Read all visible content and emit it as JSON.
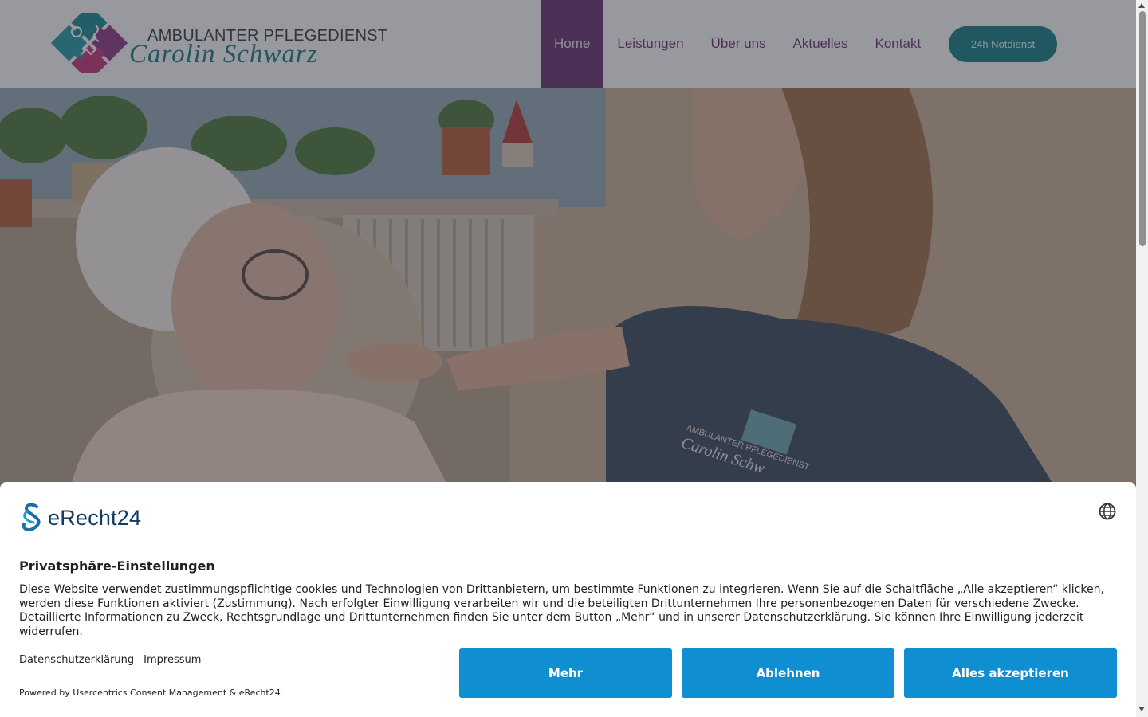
{
  "header": {
    "logo": {
      "line1": "AMBULANTER PFLEGEDIENST",
      "line2": "Carolin Schwarz"
    },
    "nav": [
      {
        "label": "Home",
        "active": true
      },
      {
        "label": "Leistungen",
        "active": false
      },
      {
        "label": "Über uns",
        "active": false
      },
      {
        "label": "Aktuelles",
        "active": false
      },
      {
        "label": "Kontakt",
        "active": false
      }
    ],
    "cta_label": "24h Notdienst"
  },
  "hero": {
    "shirt_print": {
      "line1": "AMBULANTER PFLEGEDIENST",
      "line2": "Carolin Schw"
    }
  },
  "consent": {
    "brand": "eRecht24",
    "title": "Privatsphäre-Einstellungen",
    "text": "Diese Website verwendet zustimmungspflichtige cookies und Technologien von Drittanbietern, um bestimmte Funktionen zu integrieren. Wenn Sie auf die Schaltfläche „Alle akzeptieren“ klicken, werden diese Funktionen aktiviert (Zustimmung). Nach erfolgter Einwilligung verarbeiten wir und die beteiligten Drittunternehmen Ihre personenbezogenen Daten für verschiedene Zwecke. Detaillierte Informationen zu Zweck, Rechtsgrundlage und Drittunternehmen finden Sie unter dem Button „Mehr“ und in unserer Datenschutzerklärung. Sie können Ihre Einwilligung jederzeit widerrufen.",
    "links": {
      "privacy": "Datenschutzerklärung",
      "imprint": "Impressum"
    },
    "powered_by": "Powered by Usercentrics Consent Management & eRecht24",
    "buttons": {
      "more": "Mehr",
      "decline": "Ablehnen",
      "accept_all": "Alles akzeptieren"
    },
    "button_color": "#0f8fd1"
  },
  "colors": {
    "brand_purple": "#6b3a74",
    "brand_teal": "#1d7f88"
  }
}
